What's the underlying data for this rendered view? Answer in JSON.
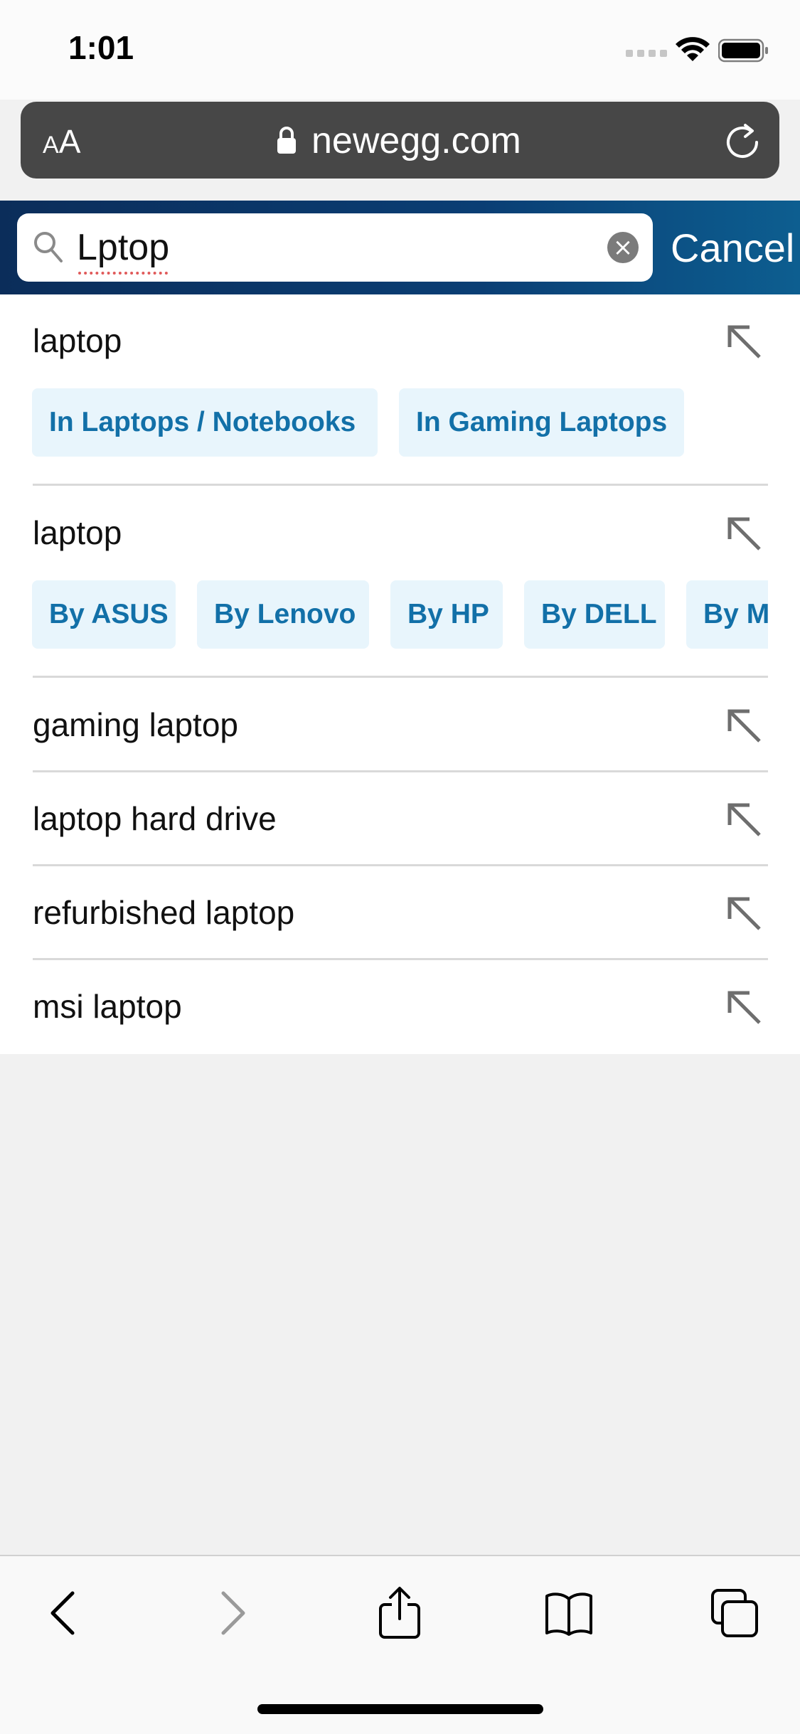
{
  "status_bar": {
    "time": "1:01"
  },
  "browser": {
    "text_size_label_small": "A",
    "text_size_label_large": "A",
    "domain": "newegg.com"
  },
  "search": {
    "query": "Lptop",
    "cancel_label": "Cancel"
  },
  "suggestions": [
    {
      "text": "laptop",
      "chips": [
        "In Laptops / Notebooks",
        "In Gaming Laptops"
      ]
    },
    {
      "text": "laptop",
      "chips": [
        "By ASUS",
        "By Lenovo",
        "By HP",
        "By DELL",
        "By M"
      ]
    },
    {
      "text": "gaming laptop"
    },
    {
      "text": "laptop hard drive"
    },
    {
      "text": "refurbished laptop"
    },
    {
      "text": "msi laptop"
    }
  ],
  "colors": {
    "header_gradient_start": "#0b2d5a",
    "header_gradient_end": "#0d5e90",
    "chip_background": "#e8f5fc",
    "chip_text": "#1270a8",
    "url_bar": "#474747"
  },
  "toolbar": {
    "icons": [
      "back-icon",
      "forward-icon",
      "share-icon",
      "bookmarks-icon",
      "tabs-icon"
    ]
  }
}
